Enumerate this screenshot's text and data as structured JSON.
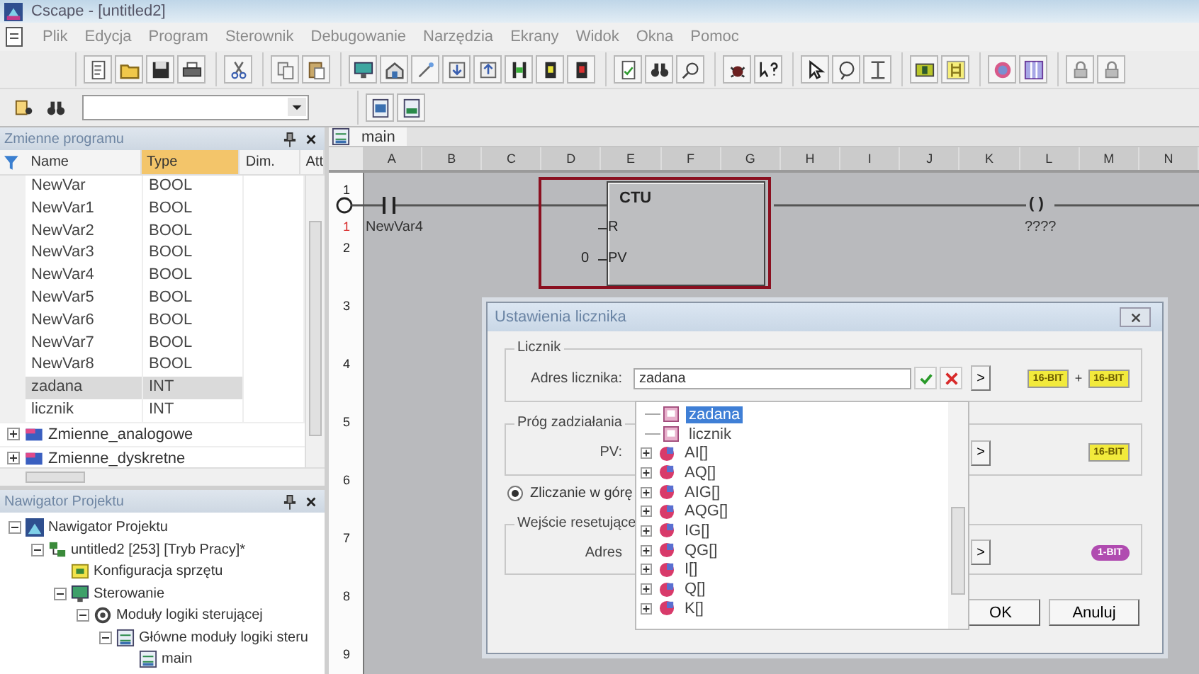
{
  "window": {
    "title": "Cscape - [untitled2]"
  },
  "menu": [
    "Plik",
    "Edycja",
    "Program",
    "Sterownik",
    "Debugowanie",
    "Narzędzia",
    "Ekrany",
    "Widok",
    "Okna",
    "Pomoc"
  ],
  "variables": {
    "title": "Zmienne programu",
    "columns": [
      {
        "label": "Name",
        "sorted": false
      },
      {
        "label": "Type",
        "sorted": true
      },
      {
        "label": "Dim.",
        "sorted": false
      },
      {
        "label": "Att",
        "sorted": false
      }
    ],
    "rows": [
      {
        "name": "NewVar",
        "type": "BOOL",
        "selected": false
      },
      {
        "name": "NewVar1",
        "type": "BOOL",
        "selected": false
      },
      {
        "name": "NewVar2",
        "type": "BOOL",
        "selected": false
      },
      {
        "name": "NewVar3",
        "type": "BOOL",
        "selected": false
      },
      {
        "name": "NewVar4",
        "type": "BOOL",
        "selected": false
      },
      {
        "name": "NewVar5",
        "type": "BOOL",
        "selected": false
      },
      {
        "name": "NewVar6",
        "type": "BOOL",
        "selected": false
      },
      {
        "name": "NewVar7",
        "type": "BOOL",
        "selected": false
      },
      {
        "name": "NewVar8",
        "type": "BOOL",
        "selected": false
      },
      {
        "name": "zadana",
        "type": "INT",
        "selected": true
      },
      {
        "name": "licznik",
        "type": "INT",
        "selected": false
      }
    ],
    "groups": [
      {
        "label": "Zmienne_analogowe",
        "expanded": false
      },
      {
        "label": "Zmienne_dyskretne",
        "expanded": false
      }
    ]
  },
  "navigator": {
    "title": "Nawigator Projektu",
    "tree": [
      {
        "label": "Nawigator Projektu",
        "kind": "project",
        "expanded": true,
        "children": [
          {
            "label": "untitled2 [253] [Tryb Pracy]*",
            "kind": "controller",
            "expanded": true,
            "children": [
              {
                "label": "Konfiguracja sprzętu",
                "kind": "hardware"
              },
              {
                "label": "Sterowanie",
                "kind": "control",
                "expanded": true,
                "children": [
                  {
                    "label": "Moduły logiki sterującej",
                    "kind": "modules",
                    "expanded": true,
                    "children": [
                      {
                        "label": "Główne moduły logiki steru",
                        "kind": "program",
                        "expanded": true,
                        "children": [
                          {
                            "label": "main",
                            "kind": "program"
                          }
                        ]
                      }
                    ]
                  }
                ]
              }
            ]
          }
        ]
      }
    ]
  },
  "editor": {
    "tabs": [
      {
        "label": "main",
        "selected": true
      }
    ],
    "columns": [
      "A",
      "B",
      "C",
      "D",
      "E",
      "F",
      "G",
      "H",
      "I",
      "J",
      "K",
      "L",
      "M",
      "N"
    ],
    "rows": [
      "1",
      "2",
      "3",
      "4",
      "5",
      "6",
      "7",
      "8",
      "9"
    ],
    "rung_marker": "1",
    "contact": {
      "label": "NewVar4"
    },
    "block": {
      "title": "CTU",
      "selected": true,
      "inputs": [
        {
          "label": "R"
        },
        {
          "label": "PV",
          "value": "0"
        }
      ]
    },
    "coil": {
      "symbol": "( )",
      "label": "????"
    }
  },
  "dialog": {
    "title": "Ustawienia licznika",
    "counter": {
      "label": "Licznik",
      "field_label": "Adres licznika:",
      "value": "zadana",
      "browse": ">",
      "badges": [
        {
          "kind": "badge",
          "label": "16-BIT",
          "color": "#f2ea3c"
        },
        {
          "kind": "plus",
          "label": "+"
        },
        {
          "kind": "badge",
          "label": "16-BIT",
          "color": "#f2ea3c"
        }
      ]
    },
    "threshold": {
      "label": "Próg zadziałania",
      "field_label": "PV:",
      "browse": ">",
      "badges": [
        {
          "kind": "badge",
          "label": "16-BIT",
          "color": "#f2ea3c"
        }
      ]
    },
    "count_up": {
      "label": "Zliczanie w górę",
      "selected": true
    },
    "reset": {
      "label": "Wejście resetujące",
      "field_label": "Adres",
      "browse": ">",
      "badges": [
        {
          "kind": "badge",
          "label": "1-BIT",
          "color": "#b04bb0"
        }
      ]
    },
    "dropdown": [
      {
        "label": "zadana",
        "kind": "variable",
        "selected": true
      },
      {
        "label": "licznik",
        "kind": "variable",
        "selected": false
      },
      {
        "label": "AI[]",
        "kind": "register",
        "selected": false
      },
      {
        "label": "AQ[]",
        "kind": "register",
        "selected": false
      },
      {
        "label": "AIG[]",
        "kind": "register",
        "selected": false
      },
      {
        "label": "AQG[]",
        "kind": "register",
        "selected": false
      },
      {
        "label": "IG[]",
        "kind": "register",
        "selected": false
      },
      {
        "label": "QG[]",
        "kind": "register",
        "selected": false
      },
      {
        "label": "I[]",
        "kind": "register",
        "selected": false
      },
      {
        "label": "Q[]",
        "kind": "register",
        "selected": false
      },
      {
        "label": "K[]",
        "kind": "register",
        "selected": false
      }
    ],
    "buttons": [
      "OK",
      "Anuluj"
    ]
  }
}
